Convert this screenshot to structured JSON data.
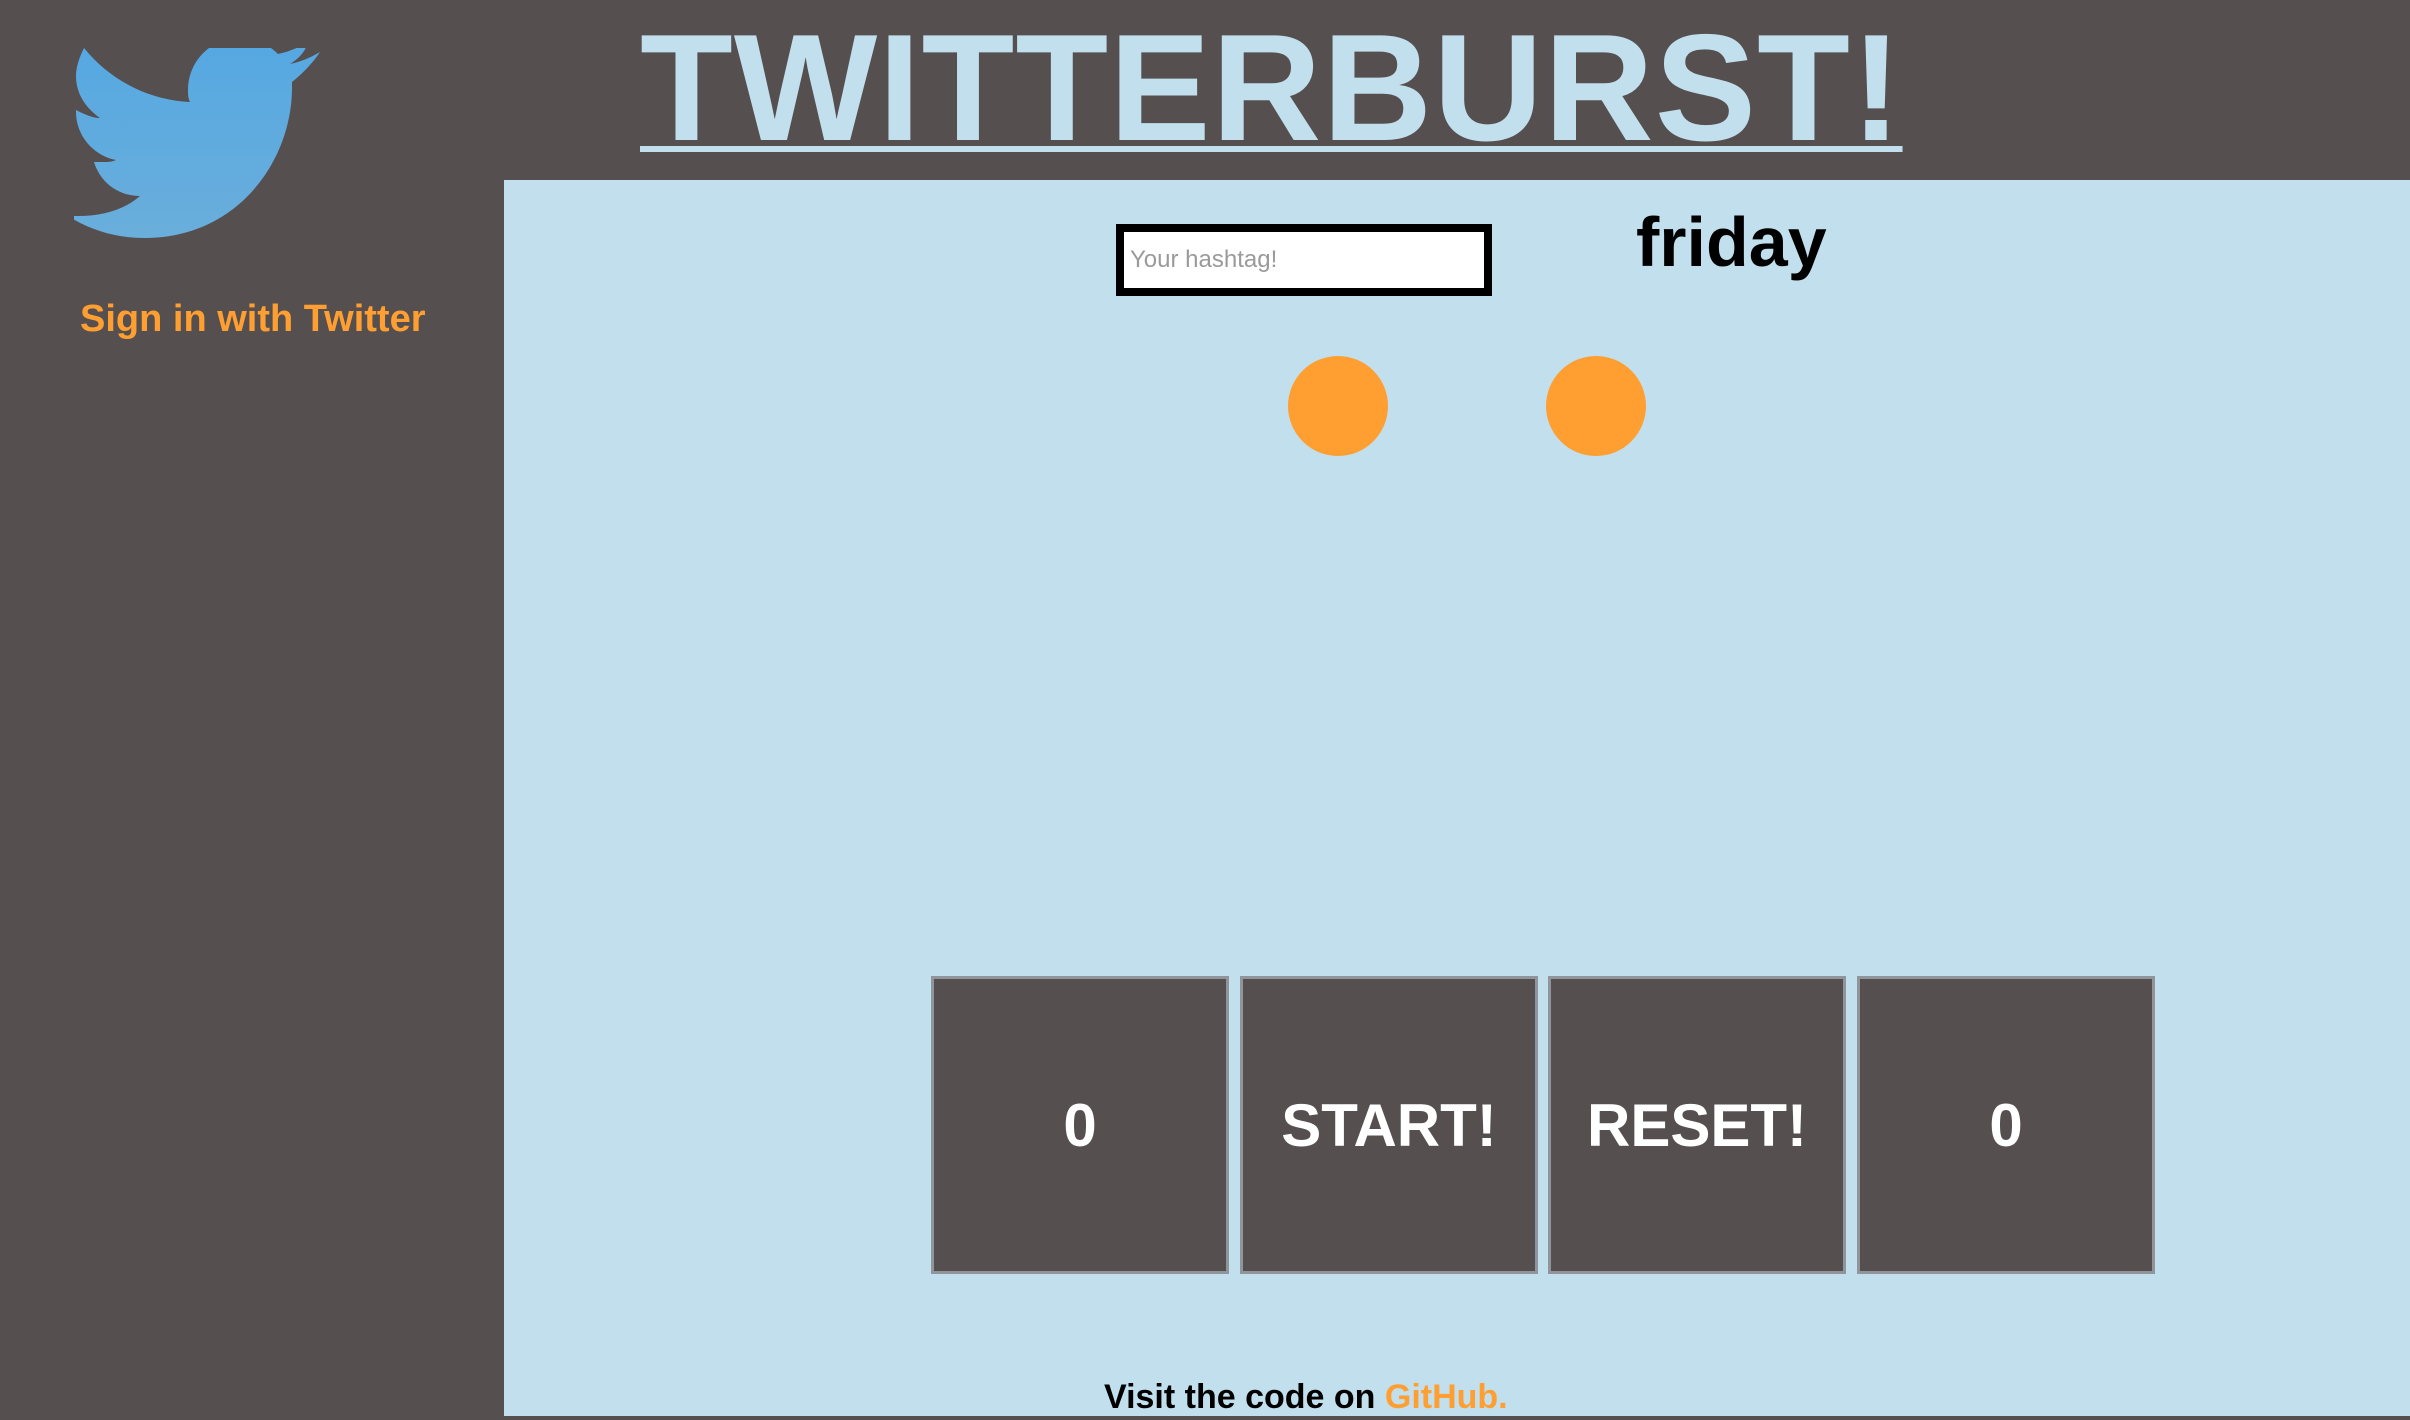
{
  "app": {
    "title": "TWITTERBURST!"
  },
  "sidebar": {
    "logo_icon": "twitter-bird-icon",
    "signin_label": "Sign in with Twitter"
  },
  "main": {
    "hashtag_input": {
      "placeholder": "Your hashtag!",
      "value": ""
    },
    "current_hashtag": "friday",
    "tiles": {
      "count_left": "0",
      "start_label": "START!",
      "reset_label": "RESET!",
      "count_right": "0"
    }
  },
  "footer": {
    "text": "Visit the code on ",
    "link_label": "GitHub."
  },
  "colors": {
    "dark": "#564f50",
    "light_blue": "#c1dfec",
    "orange": "#ff9f32",
    "twitter_blue": "#5aa9e0"
  }
}
